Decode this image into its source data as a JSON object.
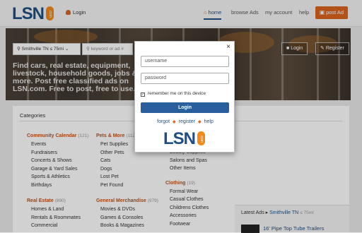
{
  "header": {
    "logo_text": "LSN",
    "logo_badge": ".com",
    "login_label": "Login",
    "nav": {
      "home": "home",
      "browse_ads": "browse Ads",
      "my_account": "my account",
      "help": "help"
    },
    "post_ad": "post Ad"
  },
  "hero": {
    "location": "Smithville TN ≤ 75mi",
    "search_placeholder": "keyword or ad #",
    "login_btn": "Login",
    "register_btn": "Register",
    "tagline": "Find cars, real estate, equipment, livestock, household goods, jobs & more. Post free classified ads on LSN.com. Free to post, free to use."
  },
  "categories_title": "Categories",
  "columns": [
    {
      "groups": [
        {
          "title": "Community Calendar",
          "count": "(121)",
          "items": [
            "Events",
            "Fundraisers",
            "Concerts & Shows",
            "Garage & Yard Sales",
            "Sports & Athletics",
            "Birthdays"
          ]
        },
        {
          "title": "Real Estate",
          "count": "(890)",
          "items": [
            "Homes & Land",
            "Rentals & Roommates",
            "Commercial"
          ]
        }
      ]
    },
    {
      "groups": [
        {
          "title": "Pets & More",
          "count": "(112)",
          "items": [
            "Pet Supplies",
            "Other Pets",
            "Cats",
            "Dogs",
            "Lost Pet",
            "Pet Found"
          ]
        },
        {
          "title": "General Merchandise",
          "count": "(979)",
          "items": [
            "Movies & DVDs",
            "Games & Consoles",
            "Books & Magazines"
          ]
        }
      ]
    },
    {
      "groups": [
        {
          "title": "",
          "count": "",
          "items": [
            "Beauty Supplies",
            "Salons and Spas",
            "Other Items"
          ]
        },
        {
          "title": "Clothing",
          "count": "(19)",
          "items": [
            "Formal Wear",
            "Casual Clothes",
            "Childrens Clothes",
            "Accessories",
            "Footwear"
          ]
        }
      ]
    }
  ],
  "latest": {
    "title": "Latest Ads",
    "location": "Smithville TN",
    "radius": "≤ 75mi",
    "first_item": "16' Pipe Top Tube Trailers"
  },
  "modal": {
    "close": "×",
    "username_placeholder": "username",
    "password_placeholder": "password",
    "remember_label": "remember me on this device",
    "login_button": "Login",
    "links": {
      "forgot": "forgot",
      "register": "register",
      "help": "help"
    },
    "logo_text": "LSN",
    "logo_badge": ".com"
  },
  "colors": {
    "brand_blue": "#1f4f82",
    "accent_orange": "#d9651f",
    "button_blue": "#2a5f9e"
  }
}
